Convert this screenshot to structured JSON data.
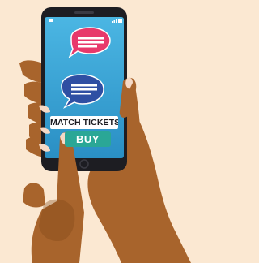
{
  "phone": {
    "ticket_label": "MATCH TICKETS",
    "buy_label": "BUY"
  },
  "icons": [
    "speech-bubble-pink-icon",
    "speech-bubble-blue-icon",
    "signal-icon",
    "battery-icon",
    "camera-icon",
    "home-button-icon"
  ],
  "colors": {
    "background": "#fbe8d2",
    "phone_body": "#1d1d22",
    "screen_top": "#4bb6e3",
    "screen_bottom": "#2a8fc4",
    "bubble_pink": "#e8396b",
    "bubble_blue": "#2f4fa3",
    "buy_button": "#2aa796",
    "skin": "#a8642c",
    "skin_dark": "#7e4418",
    "nails": "#f5d9c6"
  }
}
